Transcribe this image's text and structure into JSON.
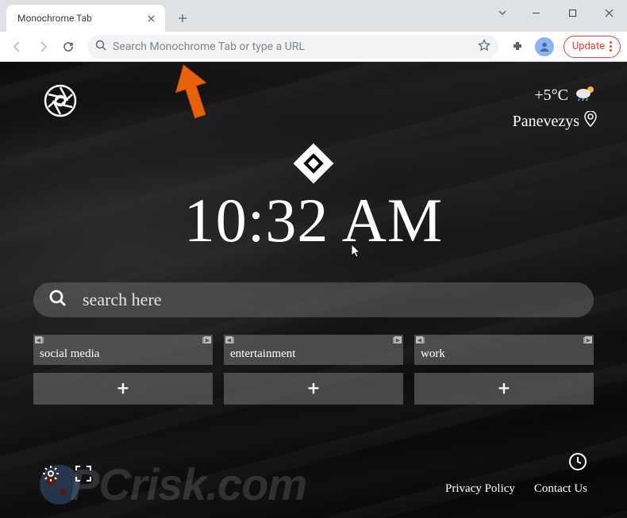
{
  "browser": {
    "tab_title": "Monochrome Tab",
    "omnibox_placeholder": "Search Monochrome Tab or type a URL",
    "update_label": "Update"
  },
  "page": {
    "weather": {
      "temperature": "+5°C",
      "location": "Panevezys"
    },
    "clock": "10:32 AM",
    "search_placeholder": "search here",
    "tiles": [
      {
        "label": "social media"
      },
      {
        "label": "entertainment"
      },
      {
        "label": "work"
      }
    ],
    "footer": {
      "privacy": "Privacy Policy",
      "contact": "Contact Us"
    }
  },
  "watermark": "PCrisk.com"
}
